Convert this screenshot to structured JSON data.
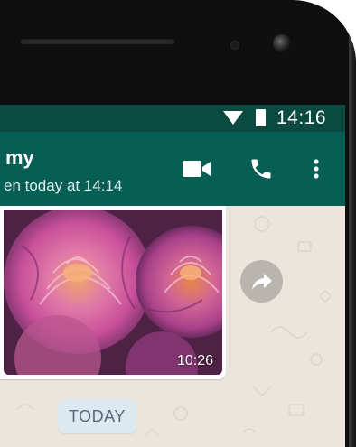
{
  "status_bar": {
    "time": "14:16",
    "wifi_icon": "wifi-icon",
    "battery_icon": "battery-icon"
  },
  "header": {
    "contact_name": "my",
    "last_seen": "en today at 14:14",
    "actions": [
      "video-call-icon",
      "phone-icon",
      "more-vert-icon"
    ]
  },
  "chat": {
    "image_message": {
      "time": "10:26",
      "content": "photo of pink roses"
    },
    "forward_icon": "forward-icon",
    "date_divider": "TODAY"
  },
  "colors": {
    "status_bar": "#0a4a40",
    "app_bar": "#075e54",
    "chat_background": "#ece5dd",
    "date_chip": "#dde9f0"
  }
}
